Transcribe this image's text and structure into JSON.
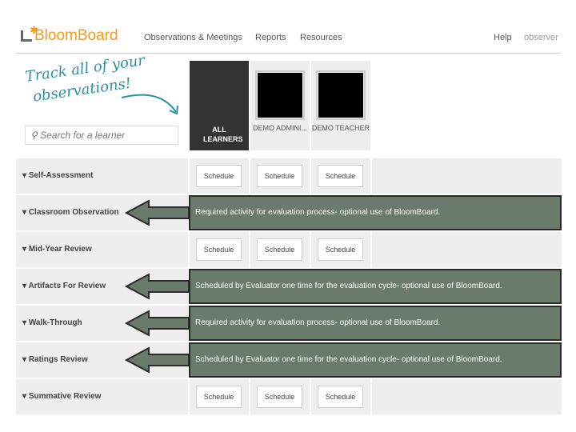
{
  "header": {
    "logo": "BloomBoard",
    "nav": [
      "Observations & Meetings",
      "Reports",
      "Resources"
    ],
    "help": "Help",
    "user": "observer"
  },
  "promo": {
    "line1": "Track all of your",
    "line2": "observations!"
  },
  "search": {
    "placeholder": "Search for a learner"
  },
  "learners": [
    {
      "name": "ALL LEARNERS"
    },
    {
      "name": "DEMO ADMINI..."
    },
    {
      "name": "DEMO TEACHER"
    }
  ],
  "schedule_label": "Schedule",
  "rows": [
    {
      "label": "Self-Assessment"
    },
    {
      "label": "Classroom Observation",
      "note": "Required activity for evaluation process- optional use of BloomBoard."
    },
    {
      "label": "Mid-Year Review"
    },
    {
      "label": "Artifacts For Review",
      "note": "Scheduled by Evaluator one time for the evaluation cycle- optional use of BloomBoard."
    },
    {
      "label": "Walk-Through",
      "note": "Required activity for evaluation process- optional use of BloomBoard."
    },
    {
      "label": "Ratings Review",
      "note": "Scheduled by Evaluator one time for the evaluation cycle- optional use of BloomBoard."
    },
    {
      "label": "Summative Review"
    }
  ],
  "colors": {
    "brand": "#f29a1a",
    "callout": "#6a7b6c",
    "promo": "#2b8fa8"
  }
}
